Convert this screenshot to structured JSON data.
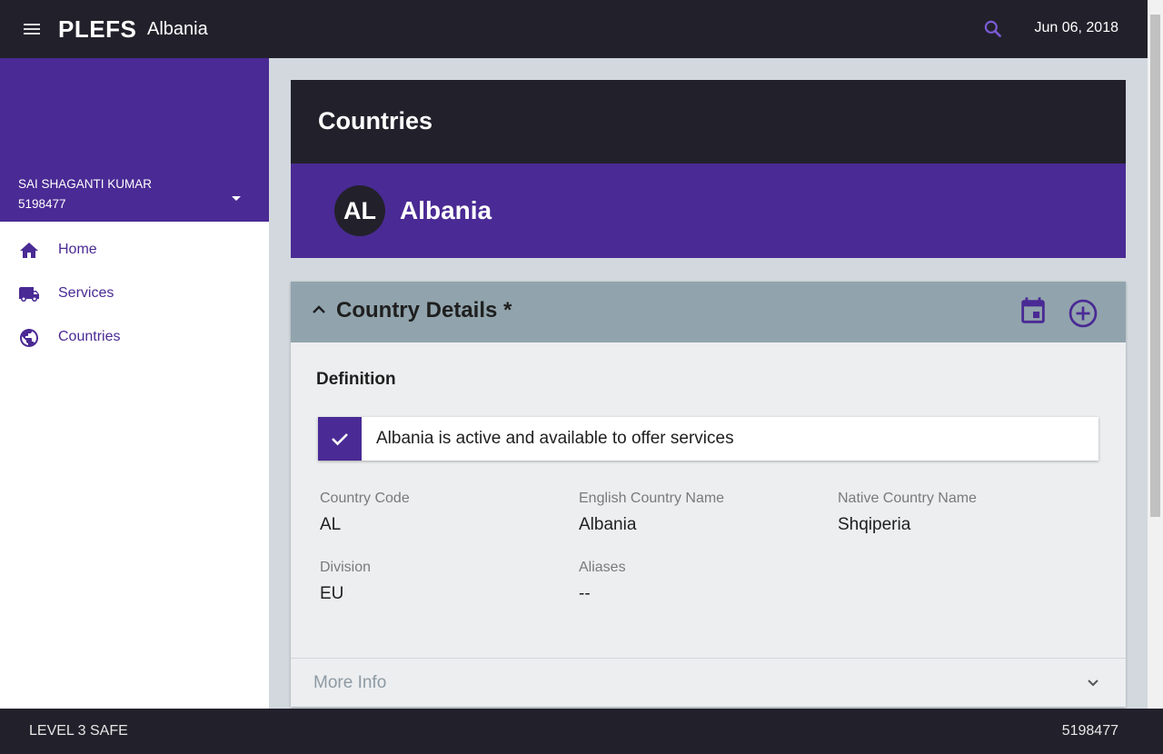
{
  "topbar": {
    "brand": "PLEFS",
    "subtitle": "Albania",
    "date": "Jun 06, 2018",
    "menu_icon": "menu-icon",
    "search_icon": "search-icon"
  },
  "sidebar": {
    "user_name": "SAI SHAGANTI KUMAR",
    "user_id": "5198477",
    "items": [
      {
        "label": "Home",
        "icon": "home-icon"
      },
      {
        "label": "Services",
        "icon": "truck-icon"
      },
      {
        "label": "Countries",
        "icon": "globe-icon"
      }
    ]
  },
  "main": {
    "page_title": "Countries",
    "country": {
      "initials": "AL",
      "name": "Albania"
    },
    "details": {
      "title": "Country Details *",
      "section_title": "Definition",
      "active_text": "Albania is active and available to offer services",
      "active_checked": true,
      "fields": [
        {
          "label": "Country Code",
          "value": "AL"
        },
        {
          "label": "English Country Name",
          "value": "Albania"
        },
        {
          "label": "Native Country Name",
          "value": "Shqiperia"
        },
        {
          "label": "Division",
          "value": "EU"
        },
        {
          "label": "Aliases",
          "value": "--"
        }
      ],
      "more_info": "More Info"
    }
  },
  "bottombar": {
    "left": "LEVEL 3 SAFE",
    "right": "5198477"
  },
  "colors": {
    "primary": "#4a2a94",
    "dark": "#22212b",
    "header_gray": "#91a4ad",
    "search_accent": "#7b5bd6"
  }
}
